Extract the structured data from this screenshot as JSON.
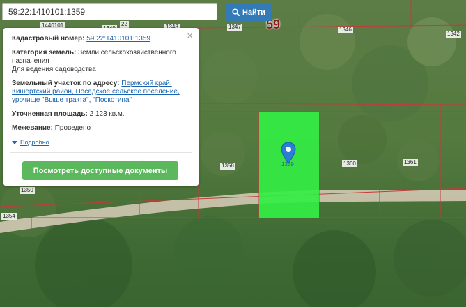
{
  "search": {
    "query": "59:22:1410101:1359",
    "button_label": "Найти"
  },
  "map": {
    "quarter_number": "59",
    "parcels": [
      "1347",
      "1346",
      "1342",
      "1358",
      "1360",
      "1361",
      "1359",
      "1354"
    ],
    "truncated_labels": [
      "1440101",
      "1349",
      "1348",
      "22",
      "1350"
    ],
    "selected_parcel_label": "1359",
    "selected_fill": "#33ee44",
    "boundary_color": "#c23b3b"
  },
  "popup": {
    "cadastral_label": "Кадастровый номер:",
    "cadastral_value": "59:22:1410101:1359",
    "category_label": "Категория земель:",
    "category_value": "Земли сельскохозяйственного назначения",
    "usage_value": "Для ведения садоводства",
    "address_label": "Земельный участок по адресу:",
    "address_value": "Пермский край, Кишертский район, Посадское сельское поселение, урочище \"Выше тракта\", \"Поскотина\"",
    "area_label": "Уточненная площадь:",
    "area_value": "2 123 кв.м.",
    "survey_label": "Межевание:",
    "survey_value": "Проведено",
    "details_label": "Подробно",
    "docs_button_label": "Посмотреть доступные документы",
    "close_symbol": "×"
  }
}
